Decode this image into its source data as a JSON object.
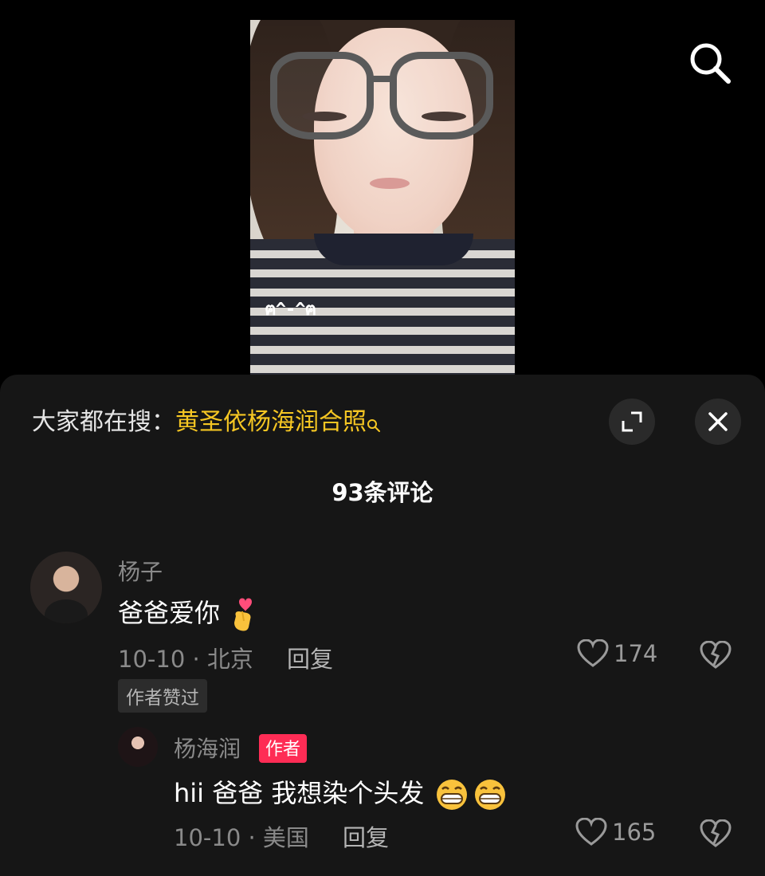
{
  "video": {
    "sticker_text": "ฅ^-^ฅ"
  },
  "search_bar": {
    "prefix": "大家都在搜：",
    "term": "黄圣依杨海润合照"
  },
  "comments_header": {
    "count_label": "93条评论"
  },
  "comments": [
    {
      "username": "杨子",
      "text": "爸爸爱你",
      "emoji": "finger-heart-emoji",
      "date": "10-10",
      "location": "北京",
      "meta": "10-10 · 北京",
      "reply_label": "回复",
      "likes": "174",
      "badge": "作者赞过"
    }
  ],
  "replies": [
    {
      "username": "杨海润",
      "author_tag": "作者",
      "text": "hii 爸爸 我想染个头发",
      "emoji": "grinning-emoji",
      "meta": "10-10 · 美国",
      "reply_label": "回复",
      "likes": "165"
    }
  ],
  "colors": {
    "accent_yellow": "#f5c623",
    "author_red": "#fe2c55",
    "sheet_bg": "#161616"
  }
}
